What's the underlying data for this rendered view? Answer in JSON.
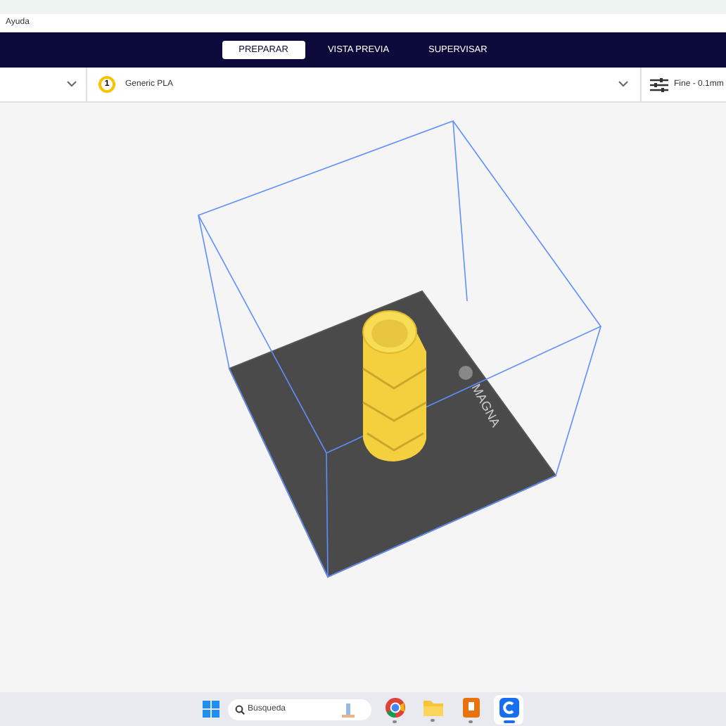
{
  "menu": [
    "Ayuda"
  ],
  "tabs": [
    {
      "label": "PREPARAR",
      "selected": true
    },
    {
      "label": "VISTA PREVIA",
      "selected": false
    },
    {
      "label": "SUPERVISAR",
      "selected": false
    }
  ],
  "toolbar": {
    "extruder_number": "1",
    "material": "Generic PLA",
    "profile": "Fine - 0.1mm"
  },
  "viewport": {
    "plate_text": "MAGNA"
  },
  "taskbar": {
    "search_placeholder": "Búsqueda",
    "apps": [
      {
        "kind": "browser",
        "selected": false
      },
      {
        "kind": "folder",
        "selected": false
      },
      {
        "kind": "book",
        "selected": false
      },
      {
        "kind": "slicer",
        "selected": true
      }
    ]
  }
}
